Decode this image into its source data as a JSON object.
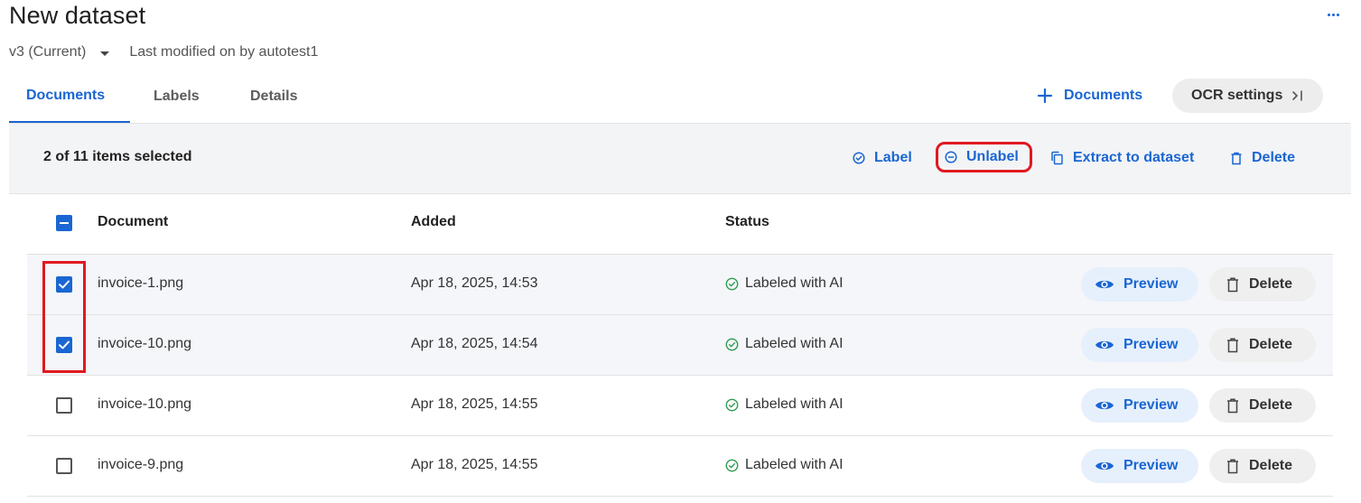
{
  "page": {
    "title": "New dataset",
    "version": "v3 (Current)",
    "modified_text": "Last modified on by autotest1"
  },
  "tabs": [
    {
      "label": "Documents",
      "active": true
    },
    {
      "label": "Labels",
      "active": false
    },
    {
      "label": "Details",
      "active": false
    }
  ],
  "header_actions": {
    "add_documents_label": "Documents",
    "ocr_settings_label": "OCR settings"
  },
  "selection_bar": {
    "count_text": "2 of 11 items selected",
    "actions": {
      "label": "Label",
      "unlabel": "Unlabel",
      "extract": "Extract to dataset",
      "delete": "Delete"
    }
  },
  "table": {
    "columns": [
      "Document",
      "Added",
      "Status"
    ],
    "select_all_state": "indeterminate",
    "rows": [
      {
        "document": "invoice-1.png",
        "added": "Apr 18, 2025, 14:53",
        "status": "Labeled with AI",
        "checked": true,
        "preview_label": "Preview",
        "delete_label": "Delete"
      },
      {
        "document": "invoice-10.png",
        "added": "Apr 18, 2025, 14:54",
        "status": "Labeled with AI",
        "checked": true,
        "preview_label": "Preview",
        "delete_label": "Delete"
      },
      {
        "document": "invoice-10.png",
        "added": "Apr 18, 2025, 14:55",
        "status": "Labeled with AI",
        "checked": false,
        "preview_label": "Preview",
        "delete_label": "Delete"
      },
      {
        "document": "invoice-9.png",
        "added": "Apr 18, 2025, 14:55",
        "status": "Labeled with AI",
        "checked": false,
        "preview_label": "Preview",
        "delete_label": "Delete"
      }
    ]
  },
  "colors": {
    "accent": "#1a66d2",
    "highlight": "#e0191f",
    "status_ok": "#2e9b4f"
  },
  "icons": [
    "more-icon",
    "chevron-down-icon",
    "plus-icon",
    "panel-expand-icon",
    "check-circle-icon",
    "minus-circle-icon",
    "copy-icon",
    "trash-icon",
    "eye-icon"
  ]
}
